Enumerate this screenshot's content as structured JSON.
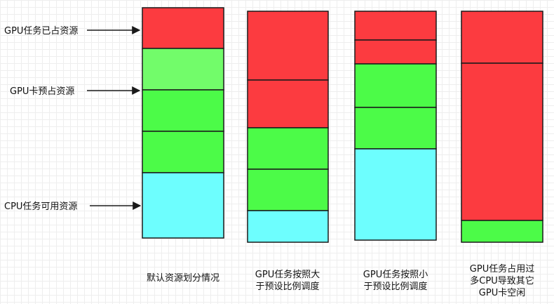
{
  "colors": {
    "gpu_used": "#fc3b40",
    "gpu_reserved_light": "#72fc6a",
    "gpu_reserved": "#4cfb48",
    "cpu_available": "#6dfefe",
    "stroke": "#1a1a1a",
    "arrow": "#1a1a1a"
  },
  "labels": [
    {
      "id": "gpu-used-label",
      "text": "GPU任务已占资源"
    },
    {
      "id": "gpu-reserved-label",
      "text": "GPU卡预占资源"
    },
    {
      "id": "cpu-available-label",
      "text": "CPU任务可用资源"
    }
  ],
  "columns": [
    {
      "caption": [
        "默认资源划分情况"
      ],
      "segments": [
        {
          "kind": "gpu_used",
          "size": 58
        },
        {
          "kind": "gpu_reserved_light",
          "size": 59
        },
        {
          "kind": "gpu_reserved",
          "size": 59
        },
        {
          "kind": "gpu_reserved",
          "size": 59
        },
        {
          "kind": "cpu_available",
          "size": 93
        }
      ]
    },
    {
      "caption": [
        "GPU任务按照大",
        "于预设比例调度"
      ],
      "segments": [
        {
          "kind": "gpu_used",
          "size": 98
        },
        {
          "kind": "gpu_used",
          "size": 68
        },
        {
          "kind": "gpu_reserved",
          "size": 59
        },
        {
          "kind": "gpu_reserved",
          "size": 59
        },
        {
          "kind": "cpu_available",
          "size": 45
        }
      ]
    },
    {
      "caption": [
        "GPU任务按照小",
        "于预设比例调度"
      ],
      "segments": [
        {
          "kind": "gpu_used",
          "size": 41
        },
        {
          "kind": "gpu_used",
          "size": 34
        },
        {
          "kind": "gpu_reserved",
          "size": 62
        },
        {
          "kind": "gpu_reserved",
          "size": 59
        },
        {
          "kind": "cpu_available",
          "size": 130
        }
      ]
    },
    {
      "caption": [
        "GPU任务占用过",
        "多CPU导致其它",
        "GPU卡空闲"
      ],
      "segments": [
        {
          "kind": "gpu_used",
          "size": 74
        },
        {
          "kind": "gpu_used",
          "size": 224
        },
        {
          "kind": "gpu_reserved",
          "size": 31
        }
      ]
    }
  ]
}
